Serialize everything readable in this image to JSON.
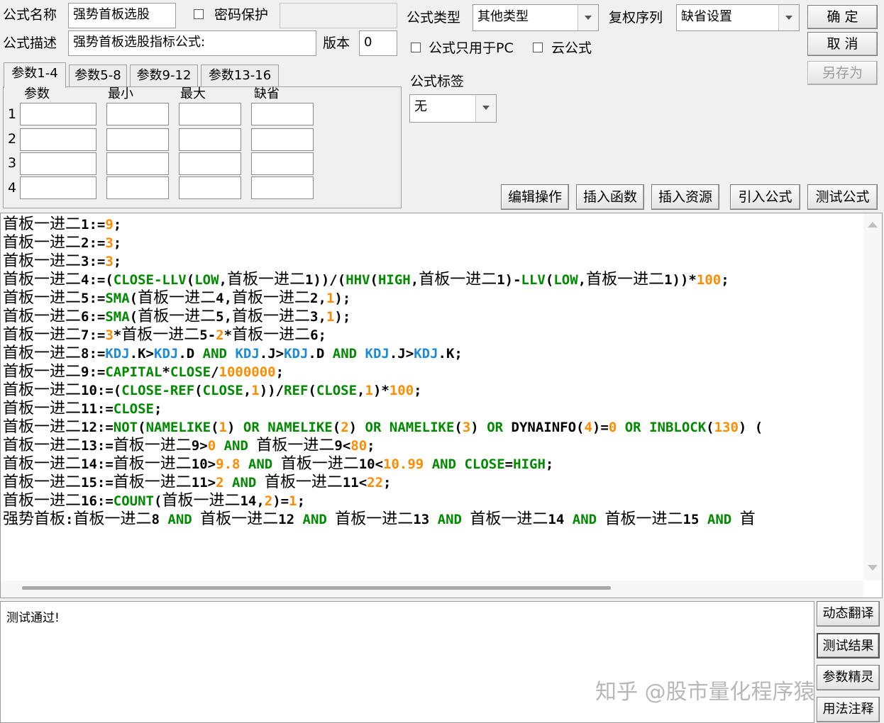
{
  "header": {
    "name_label": "公式名称",
    "name_value": "强势首板选股",
    "password_label": "密码保护",
    "desc_label": "公式描述",
    "desc_value": "强势首板选股指标公式:",
    "version_label": "版本",
    "version_value": "0",
    "type_label": "公式类型",
    "type_value": "其他类型",
    "fuquan_label": "复权序列",
    "fuquan_value": "缺省设置",
    "pc_only_label": "公式只用于PC",
    "cloud_label": "云公式",
    "tag_label": "公式标签",
    "tag_value": "无"
  },
  "buttons": {
    "ok": "确 定",
    "cancel": "取 消",
    "save_as": "另存为",
    "edit_ops": "编辑操作",
    "insert_func": "插入函数",
    "insert_res": "插入资源",
    "import_formula": "引入公式",
    "test_formula": "测试公式",
    "dyn_translate": "动态翻译",
    "test_result": "测试结果",
    "param_wizard": "参数精灵",
    "usage_notes": "用法注释"
  },
  "params": {
    "tabs": [
      "参数1-4",
      "参数5-8",
      "参数9-12",
      "参数13-16"
    ],
    "col_headers": [
      "参数",
      "最小",
      "最大",
      "缺省"
    ],
    "row_labels": [
      "1",
      "2",
      "3",
      "4"
    ]
  },
  "code_lines": [
    [
      [
        "cn",
        "首板一进二"
      ],
      [
        "k",
        "1:="
      ],
      [
        "o",
        "9"
      ],
      [
        "k",
        ";"
      ]
    ],
    [
      [
        "cn",
        "首板一进二"
      ],
      [
        "k",
        "2:="
      ],
      [
        "o",
        "3"
      ],
      [
        "k",
        ";"
      ]
    ],
    [
      [
        "cn",
        "首板一进二"
      ],
      [
        "k",
        "3:="
      ],
      [
        "o",
        "3"
      ],
      [
        "k",
        ";"
      ]
    ],
    [
      [
        "cn",
        "首板一进二"
      ],
      [
        "k",
        "4:=("
      ],
      [
        "g",
        "CLOSE-LLV"
      ],
      [
        "k",
        "("
      ],
      [
        "g",
        "LOW"
      ],
      [
        "k",
        ","
      ],
      [
        "cn",
        "首板一进二"
      ],
      [
        "k",
        "1))/("
      ],
      [
        "g",
        "HHV"
      ],
      [
        "k",
        "("
      ],
      [
        "g",
        "HIGH"
      ],
      [
        "k",
        ","
      ],
      [
        "cn",
        "首板一进二"
      ],
      [
        "k",
        "1)-"
      ],
      [
        "g",
        "LLV"
      ],
      [
        "k",
        "("
      ],
      [
        "g",
        "LOW"
      ],
      [
        "k",
        ","
      ],
      [
        "cn",
        "首板一进二"
      ],
      [
        "k",
        "1))*"
      ],
      [
        "o",
        "100"
      ],
      [
        "k",
        ";"
      ]
    ],
    [
      [
        "cn",
        "首板一进二"
      ],
      [
        "k",
        "5:="
      ],
      [
        "g",
        "SMA"
      ],
      [
        "k",
        "("
      ],
      [
        "cn",
        "首板一进二"
      ],
      [
        "k",
        "4,"
      ],
      [
        "cn",
        "首板一进二"
      ],
      [
        "k",
        "2,"
      ],
      [
        "o",
        "1"
      ],
      [
        "k",
        ");"
      ]
    ],
    [
      [
        "cn",
        "首板一进二"
      ],
      [
        "k",
        "6:="
      ],
      [
        "g",
        "SMA"
      ],
      [
        "k",
        "("
      ],
      [
        "cn",
        "首板一进二"
      ],
      [
        "k",
        "5,"
      ],
      [
        "cn",
        "首板一进二"
      ],
      [
        "k",
        "3,"
      ],
      [
        "o",
        "1"
      ],
      [
        "k",
        ");"
      ]
    ],
    [
      [
        "cn",
        "首板一进二"
      ],
      [
        "k",
        "7:="
      ],
      [
        "o",
        "3"
      ],
      [
        "k",
        "*"
      ],
      [
        "cn",
        "首板一进二"
      ],
      [
        "k",
        "5-"
      ],
      [
        "o",
        "2"
      ],
      [
        "k",
        "*"
      ],
      [
        "cn",
        "首板一进二"
      ],
      [
        "k",
        "6;"
      ]
    ],
    [
      [
        "cn",
        "首板一进二"
      ],
      [
        "k",
        "8:="
      ],
      [
        "b",
        "KDJ"
      ],
      [
        "k",
        ".K>"
      ],
      [
        "b",
        "KDJ"
      ],
      [
        "k",
        ".D "
      ],
      [
        "g",
        "AND"
      ],
      [
        "k",
        " "
      ],
      [
        "b",
        "KDJ"
      ],
      [
        "k",
        ".J>"
      ],
      [
        "b",
        "KDJ"
      ],
      [
        "k",
        ".D "
      ],
      [
        "g",
        "AND"
      ],
      [
        "k",
        " "
      ],
      [
        "b",
        "KDJ"
      ],
      [
        "k",
        ".J>"
      ],
      [
        "b",
        "KDJ"
      ],
      [
        "k",
        ".K;"
      ]
    ],
    [
      [
        "cn",
        "首板一进二"
      ],
      [
        "k",
        "9:="
      ],
      [
        "g",
        "CAPITAL"
      ],
      [
        "k",
        "*"
      ],
      [
        "g",
        "CLOSE"
      ],
      [
        "k",
        "/"
      ],
      [
        "o",
        "1000000"
      ],
      [
        "k",
        ";"
      ]
    ],
    [
      [
        "cn",
        "首板一进二"
      ],
      [
        "k",
        "10:=("
      ],
      [
        "g",
        "CLOSE-REF"
      ],
      [
        "k",
        "("
      ],
      [
        "g",
        "CLOSE"
      ],
      [
        "k",
        ","
      ],
      [
        "o",
        "1"
      ],
      [
        "k",
        "))/"
      ],
      [
        "g",
        "REF"
      ],
      [
        "k",
        "("
      ],
      [
        "g",
        "CLOSE"
      ],
      [
        "k",
        ","
      ],
      [
        "o",
        "1"
      ],
      [
        "k",
        ")*"
      ],
      [
        "o",
        "100"
      ],
      [
        "k",
        ";"
      ]
    ],
    [
      [
        "cn",
        "首板一进二"
      ],
      [
        "k",
        "11:="
      ],
      [
        "g",
        "CLOSE"
      ],
      [
        "k",
        ";"
      ]
    ],
    [
      [
        "cn",
        "首板一进二"
      ],
      [
        "k",
        "12:="
      ],
      [
        "g",
        "NOT"
      ],
      [
        "k",
        "("
      ],
      [
        "g",
        "NAMELIKE"
      ],
      [
        "k",
        "("
      ],
      [
        "o",
        "1"
      ],
      [
        "k",
        ") "
      ],
      [
        "g",
        "OR"
      ],
      [
        "k",
        " "
      ],
      [
        "g",
        "NAMELIKE"
      ],
      [
        "k",
        "("
      ],
      [
        "o",
        "2"
      ],
      [
        "k",
        ") "
      ],
      [
        "g",
        "OR"
      ],
      [
        "k",
        " "
      ],
      [
        "g",
        "NAMELIKE"
      ],
      [
        "k",
        "("
      ],
      [
        "o",
        "3"
      ],
      [
        "k",
        ") "
      ],
      [
        "g",
        "OR"
      ],
      [
        "k",
        " DYNAINFO("
      ],
      [
        "o",
        "4"
      ],
      [
        "k",
        ")="
      ],
      [
        "o",
        "0"
      ],
      [
        "k",
        " "
      ],
      [
        "g",
        "OR"
      ],
      [
        "k",
        " "
      ],
      [
        "g",
        "INBLOCK"
      ],
      [
        "k",
        "("
      ],
      [
        "o",
        "130"
      ],
      [
        "k",
        ") ("
      ]
    ],
    [
      [
        "cn",
        "首板一进二"
      ],
      [
        "k",
        "13:="
      ],
      [
        "cn",
        "首板一进二"
      ],
      [
        "k",
        "9>"
      ],
      [
        "o",
        "0"
      ],
      [
        "k",
        " "
      ],
      [
        "g",
        "AND"
      ],
      [
        "k",
        " "
      ],
      [
        "cn",
        "首板一进二"
      ],
      [
        "k",
        "9<"
      ],
      [
        "o",
        "80"
      ],
      [
        "k",
        ";"
      ]
    ],
    [
      [
        "cn",
        "首板一进二"
      ],
      [
        "k",
        "14:="
      ],
      [
        "cn",
        "首板一进二"
      ],
      [
        "k",
        "10>"
      ],
      [
        "o",
        "9.8"
      ],
      [
        "k",
        " "
      ],
      [
        "g",
        "AND"
      ],
      [
        "k",
        " "
      ],
      [
        "cn",
        "首板一进二"
      ],
      [
        "k",
        "10<"
      ],
      [
        "o",
        "10.99"
      ],
      [
        "k",
        " "
      ],
      [
        "g",
        "AND"
      ],
      [
        "k",
        " "
      ],
      [
        "g",
        "CLOSE"
      ],
      [
        "k",
        "="
      ],
      [
        "g",
        "HIGH"
      ],
      [
        "k",
        ";"
      ]
    ],
    [
      [
        "cn",
        "首板一进二"
      ],
      [
        "k",
        "15:="
      ],
      [
        "cn",
        "首板一进二"
      ],
      [
        "k",
        "11>"
      ],
      [
        "o",
        "2"
      ],
      [
        "k",
        " "
      ],
      [
        "g",
        "AND"
      ],
      [
        "k",
        " "
      ],
      [
        "cn",
        "首板一进二"
      ],
      [
        "k",
        "11<"
      ],
      [
        "o",
        "22"
      ],
      [
        "k",
        ";"
      ]
    ],
    [
      [
        "cn",
        "首板一进二"
      ],
      [
        "k",
        "16:="
      ],
      [
        "g",
        "COUNT"
      ],
      [
        "k",
        "("
      ],
      [
        "cn",
        "首板一进二"
      ],
      [
        "k",
        "14,"
      ],
      [
        "o",
        "2"
      ],
      [
        "k",
        ")="
      ],
      [
        "o",
        "1"
      ],
      [
        "k",
        ";"
      ]
    ],
    [
      [
        "cn",
        "强势首板"
      ],
      [
        "k",
        ":"
      ],
      [
        "cn",
        "首板一进二"
      ],
      [
        "k",
        "8 "
      ],
      [
        "g",
        "AND"
      ],
      [
        "k",
        " "
      ],
      [
        "cn",
        "首板一进二"
      ],
      [
        "k",
        "12 "
      ],
      [
        "g",
        "AND"
      ],
      [
        "k",
        " "
      ],
      [
        "cn",
        "首板一进二"
      ],
      [
        "k",
        "13 "
      ],
      [
        "g",
        "AND"
      ],
      [
        "k",
        " "
      ],
      [
        "cn",
        "首板一进二"
      ],
      [
        "k",
        "14 "
      ],
      [
        "g",
        "AND"
      ],
      [
        "k",
        " "
      ],
      [
        "cn",
        "首板一进二"
      ],
      [
        "k",
        "15 "
      ],
      [
        "g",
        "AND"
      ],
      [
        "k",
        " "
      ],
      [
        "cn",
        "首"
      ]
    ]
  ],
  "output_text": "测试通过!",
  "watermark": "知乎 @股市量化程序猿"
}
